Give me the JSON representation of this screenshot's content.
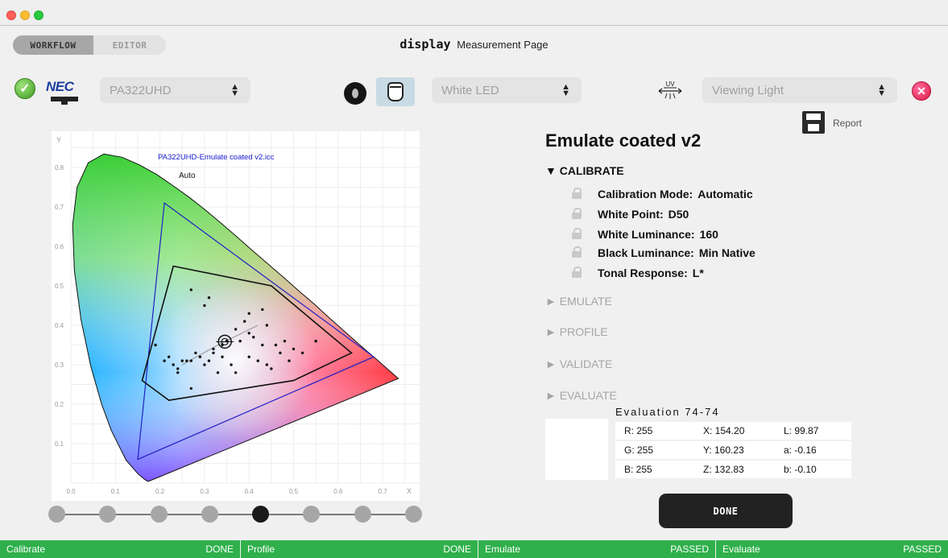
{
  "window": {
    "title_brand": "display",
    "title_text": "Measurement Page"
  },
  "mode_tabs": [
    {
      "label": "WORKFLOW",
      "active": true
    },
    {
      "label": "EDITOR",
      "active": false
    }
  ],
  "device": {
    "display_label": "PA322UHD",
    "light_source": "White LED",
    "viewing_light": "Viewing Light",
    "uv_label": "UV",
    "nec_logo": "NEC"
  },
  "report_label": "Report",
  "chart_data": {
    "type": "scatter",
    "title": "PA322UHD-Emulate coated v2.icc",
    "annotation": "Auto",
    "xlabel": "X",
    "ylabel": "Y",
    "xlim": [
      0.0,
      0.8
    ],
    "ylim": [
      0.0,
      0.9
    ],
    "x_ticks": [
      "0.0",
      "0.1",
      "0.2",
      "0.3",
      "0.4",
      "0.5",
      "0.6",
      "0.7"
    ],
    "y_ticks": [
      "0.1",
      "0.2",
      "0.3",
      "0.4",
      "0.5",
      "0.6",
      "0.7",
      "0.8"
    ],
    "grid": true,
    "spectral_locus": [
      [
        0.175,
        0.005
      ],
      [
        0.172,
        0.005
      ],
      [
        0.165,
        0.01
      ],
      [
        0.151,
        0.023
      ],
      [
        0.124,
        0.058
      ],
      [
        0.091,
        0.133
      ],
      [
        0.069,
        0.2
      ],
      [
        0.045,
        0.295
      ],
      [
        0.023,
        0.413
      ],
      [
        0.008,
        0.538
      ],
      [
        0.004,
        0.655
      ],
      [
        0.014,
        0.75
      ],
      [
        0.039,
        0.812
      ],
      [
        0.074,
        0.834
      ],
      [
        0.115,
        0.826
      ],
      [
        0.155,
        0.806
      ],
      [
        0.193,
        0.782
      ],
      [
        0.229,
        0.754
      ],
      [
        0.266,
        0.724
      ],
      [
        0.302,
        0.692
      ],
      [
        0.337,
        0.659
      ],
      [
        0.373,
        0.624
      ],
      [
        0.408,
        0.589
      ],
      [
        0.444,
        0.554
      ],
      [
        0.479,
        0.52
      ],
      [
        0.512,
        0.487
      ],
      [
        0.545,
        0.455
      ],
      [
        0.575,
        0.424
      ],
      [
        0.603,
        0.396
      ],
      [
        0.627,
        0.372
      ],
      [
        0.648,
        0.351
      ],
      [
        0.665,
        0.334
      ],
      [
        0.68,
        0.32
      ],
      [
        0.692,
        0.308
      ],
      [
        0.735,
        0.265
      ]
    ],
    "series": [
      {
        "name": "gamut-outer",
        "color": "#1f1fc4",
        "points": [
          [
            0.68,
            0.32
          ],
          [
            0.21,
            0.71
          ],
          [
            0.15,
            0.06
          ]
        ]
      },
      {
        "name": "gamut-target",
        "color": "#111111",
        "points": [
          [
            0.23,
            0.55
          ],
          [
            0.45,
            0.5
          ],
          [
            0.63,
            0.33
          ],
          [
            0.5,
            0.26
          ],
          [
            0.22,
            0.21
          ],
          [
            0.16,
            0.26
          ]
        ]
      }
    ],
    "points": [
      [
        0.27,
        0.49
      ],
      [
        0.31,
        0.47
      ],
      [
        0.3,
        0.45
      ],
      [
        0.4,
        0.43
      ],
      [
        0.43,
        0.44
      ],
      [
        0.39,
        0.41
      ],
      [
        0.37,
        0.39
      ],
      [
        0.35,
        0.36
      ],
      [
        0.34,
        0.35
      ],
      [
        0.32,
        0.34
      ],
      [
        0.31,
        0.31
      ],
      [
        0.3,
        0.3
      ],
      [
        0.29,
        0.32
      ],
      [
        0.28,
        0.33
      ],
      [
        0.27,
        0.31
      ],
      [
        0.23,
        0.3
      ],
      [
        0.21,
        0.31
      ],
      [
        0.19,
        0.35
      ],
      [
        0.22,
        0.32
      ],
      [
        0.26,
        0.31
      ],
      [
        0.38,
        0.36
      ],
      [
        0.41,
        0.37
      ],
      [
        0.43,
        0.35
      ],
      [
        0.46,
        0.35
      ],
      [
        0.48,
        0.36
      ],
      [
        0.5,
        0.34
      ],
      [
        0.52,
        0.33
      ],
      [
        0.55,
        0.36
      ],
      [
        0.47,
        0.33
      ],
      [
        0.44,
        0.3
      ],
      [
        0.42,
        0.31
      ],
      [
        0.4,
        0.32
      ],
      [
        0.36,
        0.3
      ],
      [
        0.33,
        0.28
      ],
      [
        0.24,
        0.28
      ],
      [
        0.27,
        0.24
      ],
      [
        0.24,
        0.29
      ],
      [
        0.25,
        0.31
      ],
      [
        0.37,
        0.28
      ],
      [
        0.45,
        0.29
      ],
      [
        0.49,
        0.31
      ],
      [
        0.32,
        0.33
      ],
      [
        0.34,
        0.32
      ],
      [
        0.4,
        0.38
      ],
      [
        0.44,
        0.4
      ]
    ],
    "trend_points": [
      [
        0.25,
        0.3
      ],
      [
        0.33,
        0.35
      ],
      [
        0.42,
        0.4
      ]
    ],
    "whitepoint": [
      0.3457,
      0.3585
    ]
  },
  "stepper": {
    "count": 8,
    "active_index": 4
  },
  "panel": {
    "profile_name": "Emulate coated v2",
    "calibrate_heading": "▼ CALIBRATE",
    "settings": [
      {
        "label": "Calibration Mode:",
        "value": "Automatic"
      },
      {
        "label": "White Point:",
        "value": "D50"
      },
      {
        "label": "White Luminance:",
        "value": "160"
      },
      {
        "label": "Black Luminance:",
        "value": "Min Native"
      },
      {
        "label": "Tonal Response:",
        "value": "L*"
      }
    ],
    "collapsed_sections": [
      "► EMULATE",
      "► PROFILE",
      "► VALIDATE",
      "► EVALUATE"
    ],
    "evaluation_title": "Evaluation  74-74",
    "evaluation_rows": [
      {
        "c1": "R:  255",
        "c2": "X:  154.20",
        "c3": "L:  99.87"
      },
      {
        "c1": "G:  255",
        "c2": "Y:  160.23",
        "c3": "a:  -0.16"
      },
      {
        "c1": "B:  255",
        "c2": "Z:  132.83",
        "c3": "b:  -0.10"
      }
    ],
    "done_label": "DONE"
  },
  "status_bar": [
    {
      "name": "Calibrate",
      "state": "DONE"
    },
    {
      "name": "Profile",
      "state": "DONE"
    },
    {
      "name": "Emulate",
      "state": "PASSED"
    },
    {
      "name": "Evaluate",
      "state": "PASSED"
    }
  ]
}
